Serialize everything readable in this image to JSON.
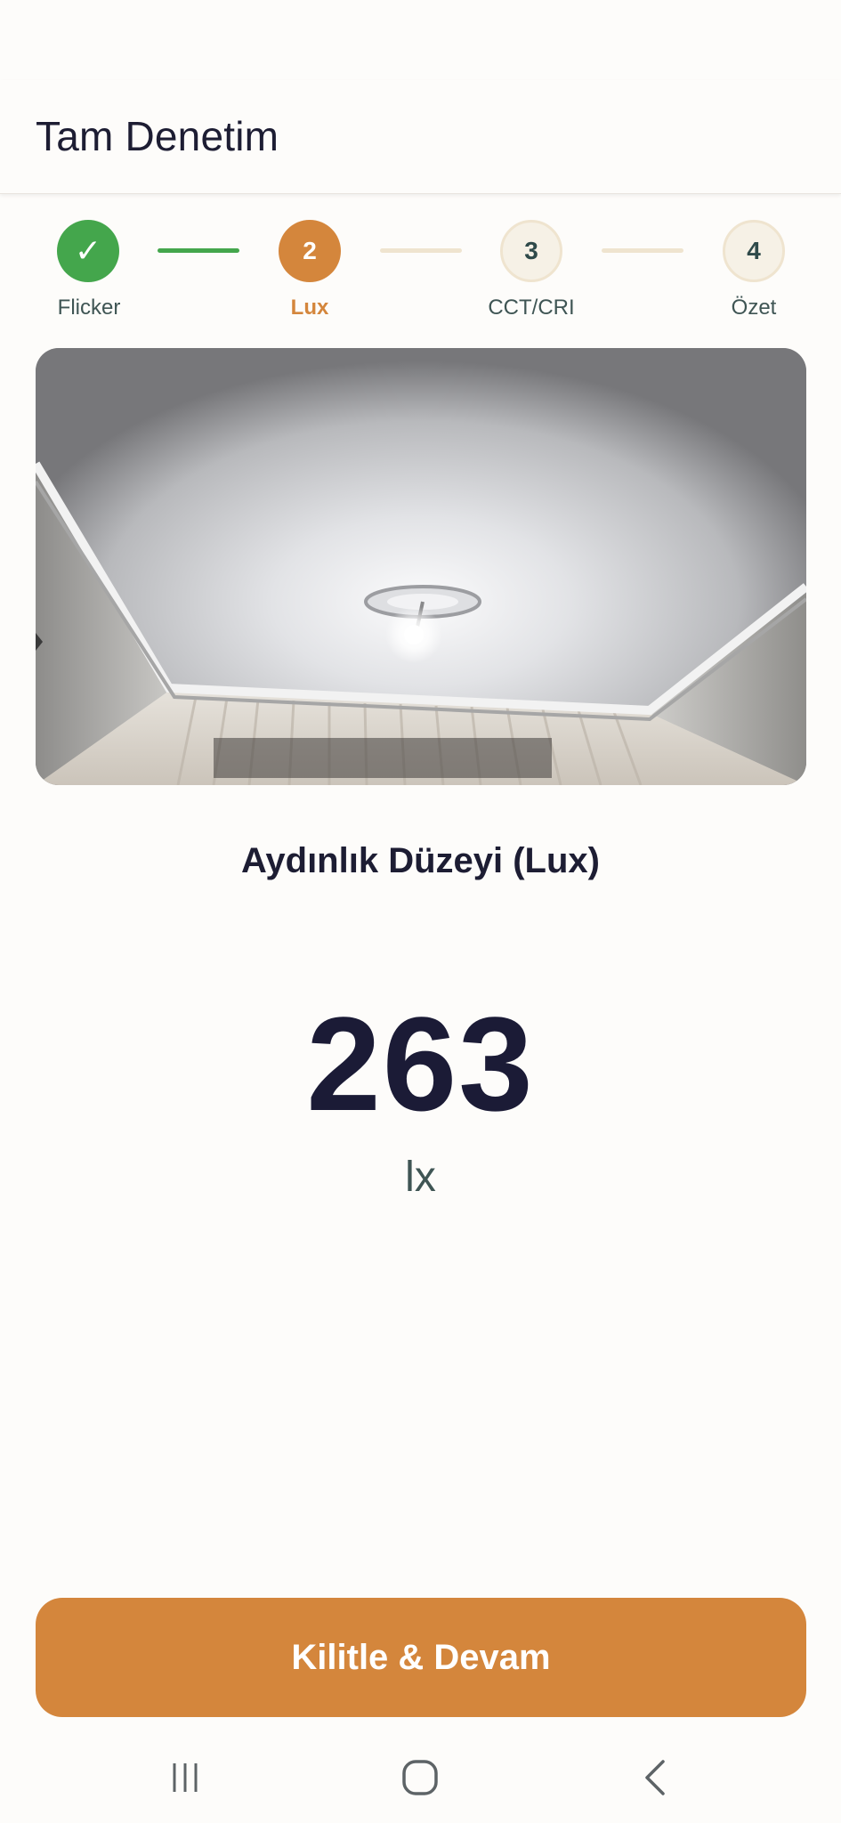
{
  "header": {
    "title": "Tam Denetim"
  },
  "stepper": {
    "steps": [
      {
        "number": "✓",
        "label": "Flicker",
        "state": "done"
      },
      {
        "number": "2",
        "label": "Lux",
        "state": "active"
      },
      {
        "number": "3",
        "label": "CCT/CRI",
        "state": "todo"
      },
      {
        "number": "4",
        "label": "Özet",
        "state": "todo"
      }
    ]
  },
  "measurement": {
    "title": "Aydınlık Düzeyi (Lux)",
    "value": "263",
    "unit": "lx"
  },
  "actions": {
    "lock_label": "Kilitle & Devam"
  },
  "colors": {
    "accent": "#d4863c",
    "done": "#44a64c",
    "text_dark": "#1d1d33",
    "pending": "#efe4cf"
  },
  "nav": {
    "icons": [
      "recent-apps-icon",
      "home-icon",
      "back-icon"
    ]
  }
}
